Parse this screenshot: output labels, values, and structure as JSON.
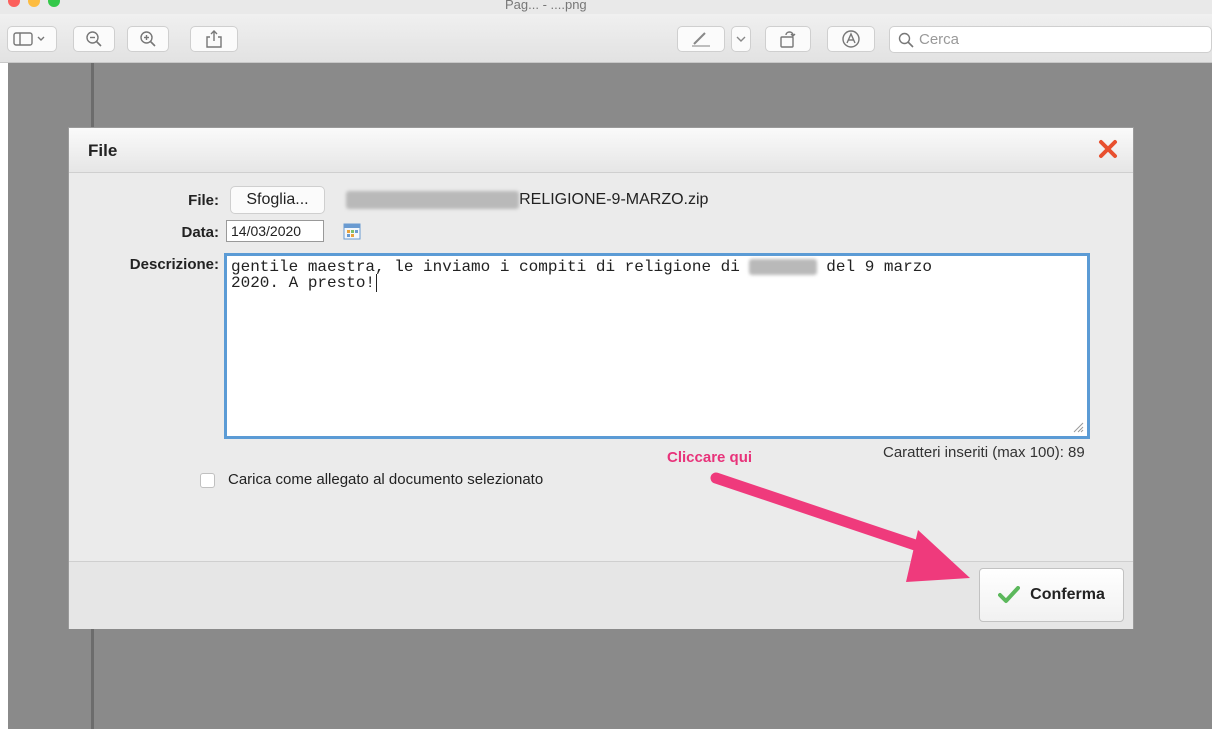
{
  "window": {
    "title": "Pag... - ....png"
  },
  "toolbar": {
    "search_placeholder": "Cerca"
  },
  "dialog": {
    "title": "File",
    "file_label": "File:",
    "browse_label": "Sfoglia...",
    "file_name_visible": "RELIGIONE-9-MARZO.zip",
    "date_label": "Data:",
    "date_value": "14/03/2020",
    "description_label": "Descrizione:",
    "description_line1_prefix": "gentile maestra, le inviamo i compiti di religione di ",
    "description_line1_suffix": " del 9 marzo",
    "description_line2": "2020. A presto!",
    "char_counter": "Caratteri inseriti (max 100): 89",
    "checkbox_label": "Carica come allegato al documento selezionato",
    "confirm_label": "Conferma"
  },
  "annotation": {
    "text": "Cliccare qui",
    "color": "#e8337a"
  },
  "colors": {
    "close_x": "#e8502f",
    "confirm_check": "#5cb85c",
    "focus_border": "#5b9bd5"
  }
}
